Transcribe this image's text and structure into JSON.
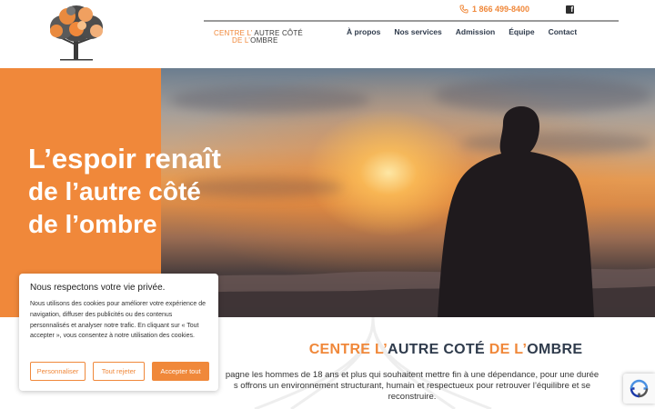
{
  "header": {
    "phone": "1 866 499-8400",
    "brand": {
      "p1": "CENTRE L",
      "p2": "’",
      "p3": "AUTRE CÔTÉ",
      "p4": "DE L",
      "p5": "’",
      "p6": "OMBRE"
    },
    "nav": [
      "À propos",
      "Nos services",
      "Admission",
      "Équipe",
      "Contact"
    ]
  },
  "hero": {
    "line1": "L’espoir renaît",
    "line2": "de l’autre côté",
    "line3": "de l’ombre"
  },
  "section": {
    "title": {
      "t1": "CENTRE L’",
      "t2": "AUTRE COTÉ",
      "t3": "DE L’",
      "t4": "OMBRE"
    },
    "text1": "pagne les hommes de 18 ans et plus qui souhaitent mettre fin à une dépendance, pour une durée",
    "text2": "s offrons un environnement structurant, humain et respectueux pour retrouver l’équilibre et se",
    "text3": "reconstruire."
  },
  "cookie": {
    "title": "Nous respectons votre vie privée.",
    "body": "Nous utilisons des cookies pour améliorer votre expérience de navigation, diffuser des publicités ou des contenus personnalisés et analyser notre trafic. En cliquant sur « Tout accepter », vous consentez à notre utilisation des cookies.",
    "customize": "Personnaliser",
    "reject": "Tout rejeter",
    "accept": "Accepter tout"
  },
  "colors": {
    "accent": "#f0883a",
    "navy": "#2f3b4c"
  },
  "icons": {
    "phone": "phone-icon",
    "social": "facebook-icon",
    "captcha": "recaptcha-icon"
  }
}
